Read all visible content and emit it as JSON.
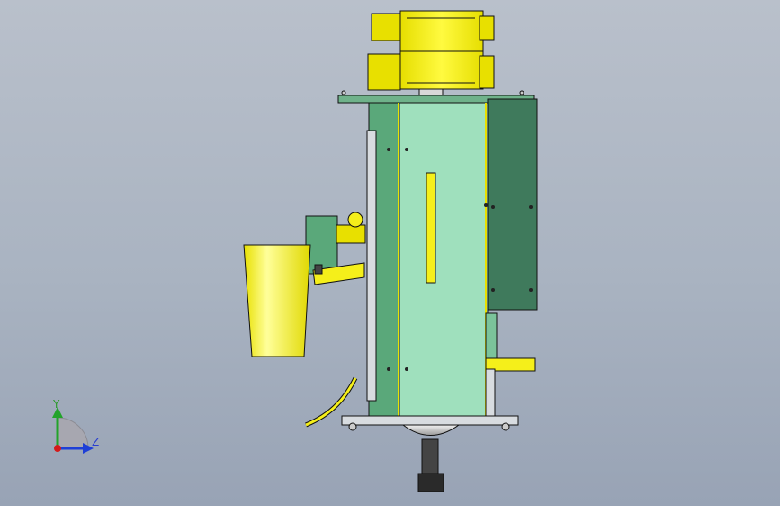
{
  "axes": {
    "y_label": "Y",
    "z_label": "Z",
    "colors": {
      "y": "#22a32a",
      "z": "#1f3fd6",
      "origin": "#d41a1a"
    }
  },
  "colors": {
    "yellow": "#f5ef1a",
    "yellow_dark": "#b8b000",
    "pale_green": "#9fe0bd",
    "mid_green": "#5aa87a",
    "dark_green": "#3f7a5c",
    "steel": "#d8dce0",
    "outline": "#111111"
  }
}
